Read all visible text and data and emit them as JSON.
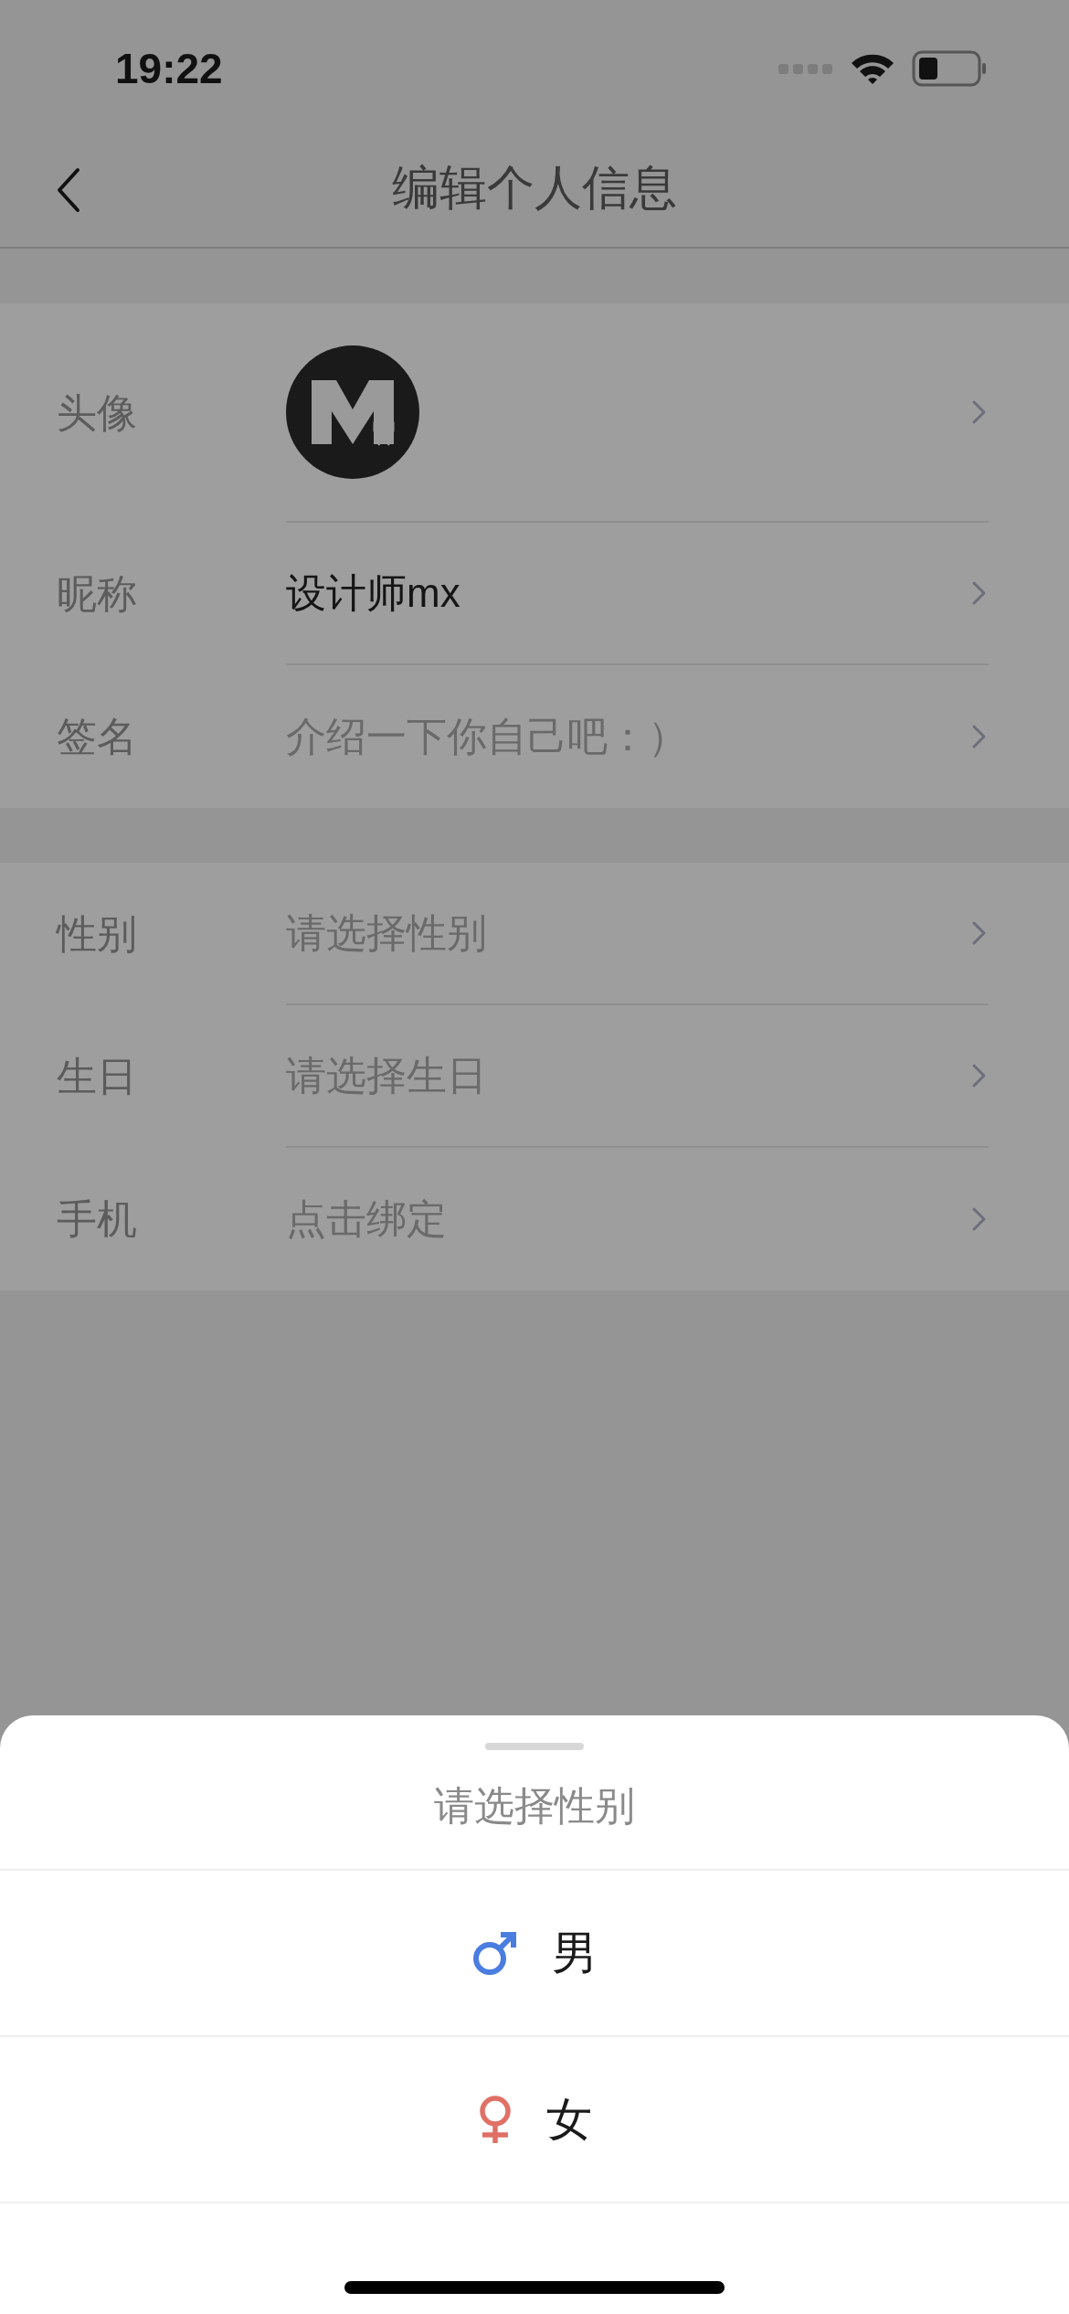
{
  "status_bar": {
    "time": "19:22"
  },
  "nav": {
    "title": "编辑个人信息"
  },
  "sections": [
    {
      "rows": [
        {
          "kind": "avatar",
          "label": "头像"
        },
        {
          "kind": "text",
          "label": "昵称",
          "value": "设计师mx"
        },
        {
          "kind": "text",
          "label": "签名",
          "placeholder": "介绍一下你自己吧：）"
        }
      ]
    },
    {
      "rows": [
        {
          "kind": "text",
          "label": "性别",
          "placeholder": "请选择性别"
        },
        {
          "kind": "text",
          "label": "生日",
          "placeholder": "请选择生日"
        },
        {
          "kind": "text",
          "label": "手机",
          "placeholder": "点击绑定"
        }
      ]
    }
  ],
  "sheet": {
    "title": "请选择性别",
    "options": [
      {
        "kind": "male",
        "label": "男"
      },
      {
        "kind": "female",
        "label": "女"
      }
    ]
  }
}
